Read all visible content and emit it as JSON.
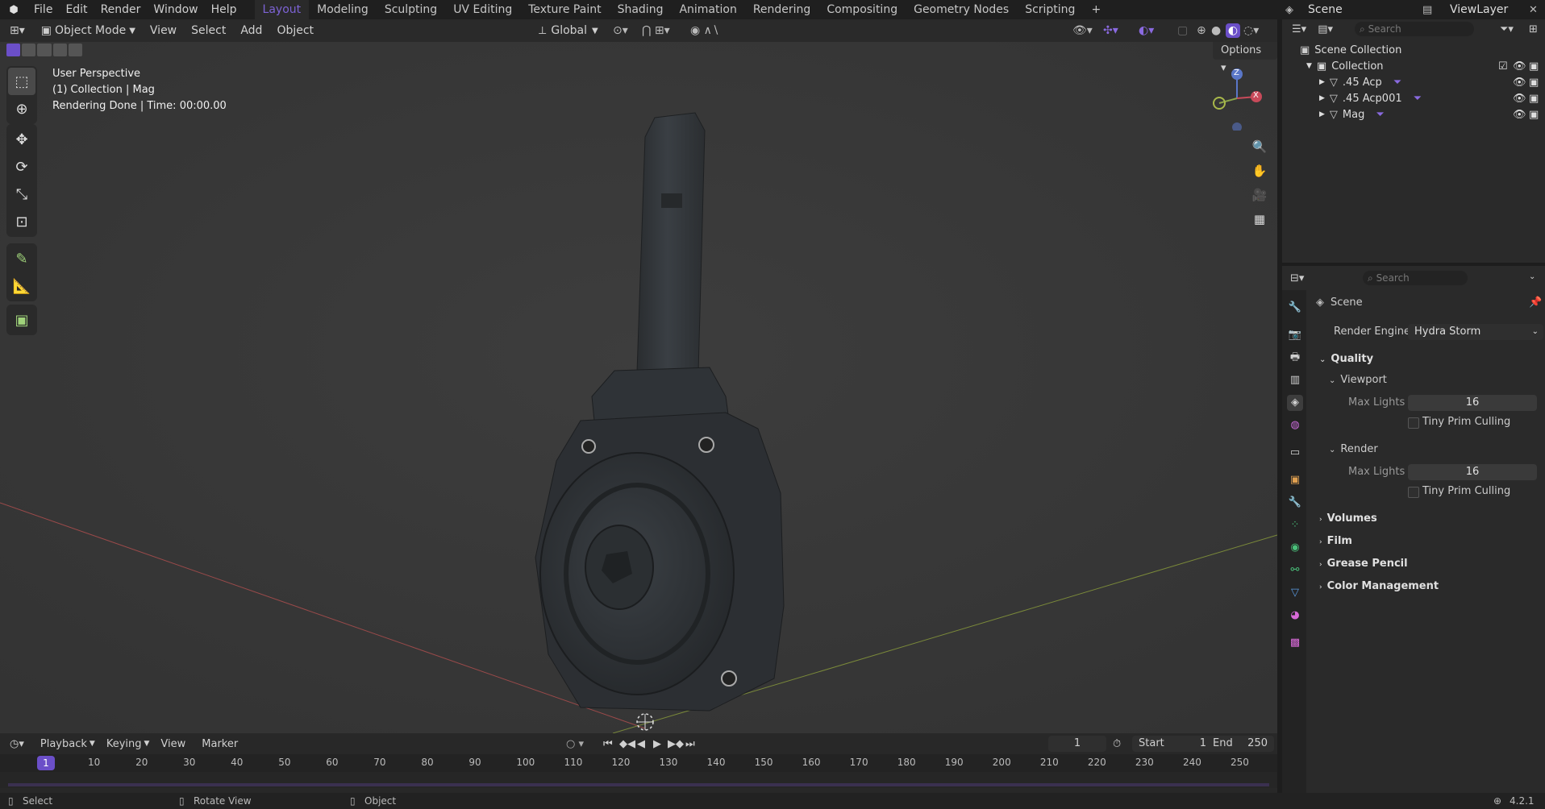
{
  "topbar": {
    "menus": [
      "File",
      "Edit",
      "Render",
      "Window",
      "Help"
    ],
    "workspaces": [
      "Layout",
      "Modeling",
      "Sculpting",
      "UV Editing",
      "Texture Paint",
      "Shading",
      "Animation",
      "Rendering",
      "Compositing",
      "Geometry Nodes",
      "Scripting"
    ],
    "active_workspace": "Layout",
    "scene_label": "Scene",
    "viewlayer_label": "ViewLayer"
  },
  "viewport_header": {
    "mode": "Object Mode",
    "menus": [
      "View",
      "Select",
      "Add",
      "Object"
    ],
    "transform": "Global",
    "options": "Options"
  },
  "viewport": {
    "line1": "User Perspective",
    "line2": "(1) Collection | Mag",
    "line3": "Rendering Done | Time: 00:00.00",
    "gizmo_z": "Z",
    "gizmo_x": "X"
  },
  "outliner": {
    "search_placeholder": "Search",
    "root": "Scene Collection",
    "collection": "Collection",
    "items": [
      ".45 Acp",
      ".45 Acp001",
      "Mag"
    ]
  },
  "properties": {
    "search_placeholder": "Search",
    "context": "Scene",
    "render_engine_label": "Render Engine",
    "render_engine": "Hydra Storm",
    "quality": "Quality",
    "viewport": "Viewport",
    "max_lights_label": "Max Lights",
    "viewport_max_lights": "16",
    "tiny_prim": "Tiny Prim Culling",
    "render": "Render",
    "render_max_lights": "16",
    "sections": [
      "Volumes",
      "Film",
      "Grease Pencil",
      "Color Management"
    ]
  },
  "timeline": {
    "menus": [
      "Playback",
      "Keying",
      "View",
      "Marker"
    ],
    "current_frame": "1",
    "start_label": "Start",
    "start": "1",
    "end_label": "End",
    "end": "250",
    "ticks": [
      "10",
      "20",
      "30",
      "40",
      "50",
      "60",
      "70",
      "80",
      "90",
      "100",
      "110",
      "120",
      "130",
      "140",
      "150",
      "160",
      "170",
      "180",
      "190",
      "200",
      "210",
      "220",
      "230",
      "240",
      "250"
    ],
    "playhead": "1"
  },
  "statusbar": {
    "select": "Select",
    "rotate": "Rotate View",
    "object": "Object",
    "version": "4.2.1"
  }
}
